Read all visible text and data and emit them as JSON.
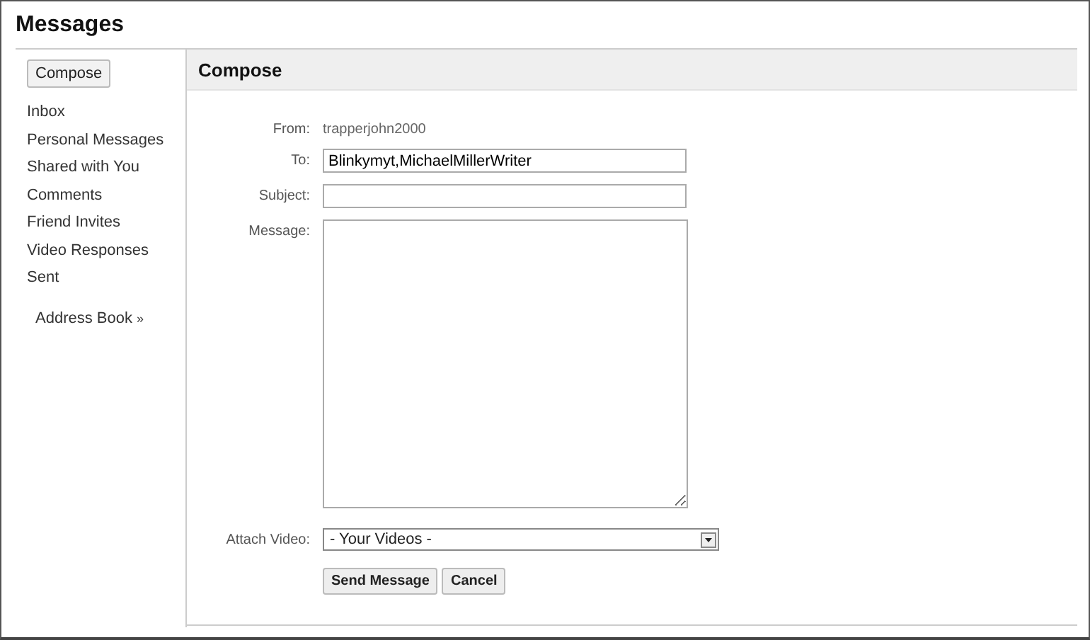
{
  "page_title": "Messages",
  "sidebar": {
    "compose_button": "Compose",
    "items": [
      {
        "label": "Inbox"
      },
      {
        "label": "Personal Messages"
      },
      {
        "label": "Shared with You"
      },
      {
        "label": "Comments"
      },
      {
        "label": "Friend Invites"
      },
      {
        "label": "Video Responses"
      },
      {
        "label": "Sent"
      }
    ],
    "address_book": {
      "label": "Address Book",
      "arrow": "»"
    }
  },
  "panel": {
    "title": "Compose",
    "from": {
      "label": "From:",
      "value": "trapperjohn2000"
    },
    "to": {
      "label": "To:",
      "value": "Blinkymyt,MichaelMillerWriter"
    },
    "subject": {
      "label": "Subject:"
    },
    "message": {
      "label": "Message:"
    },
    "attach_video": {
      "label": "Attach Video:",
      "value": "- Your Videos -"
    },
    "buttons": [
      "Send Message",
      "Cancel"
    ]
  }
}
